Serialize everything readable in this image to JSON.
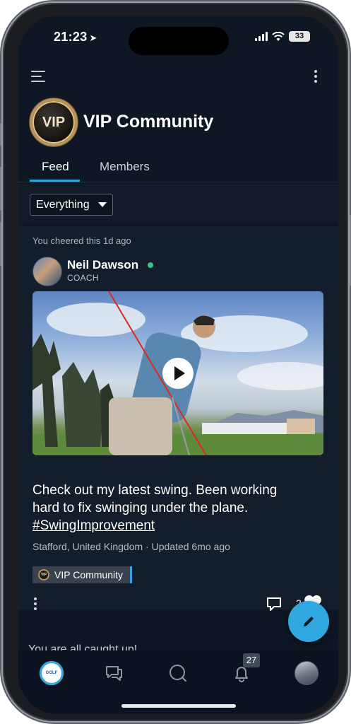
{
  "status_bar": {
    "time": "21:23",
    "battery": "33"
  },
  "header": {
    "community_title": "VIP Community",
    "badge_text": "VIP"
  },
  "tabs": [
    {
      "label": "Feed",
      "active": true
    },
    {
      "label": "Members",
      "active": false
    }
  ],
  "filter": {
    "selected": "Everything"
  },
  "post": {
    "activity": "You cheered this 1d ago",
    "author": {
      "name": "Neil Dawson",
      "role": "COACH",
      "online": true
    },
    "body_lines": [
      "Check out my latest swing. Been working",
      "hard to fix swinging under the plane."
    ],
    "hashtag": "#SwingImprovement",
    "meta": "Stafford, United Kingdom · Updated 6mo ago",
    "community_chip": "VIP Community",
    "like_count": "2"
  },
  "feed_footer": "You are all caught up!",
  "bottom_nav": {
    "notification_count": "27",
    "logo_text": "GOLF"
  },
  "icons": {
    "menu": "hamburger-menu-icon",
    "more": "more-vertical-icon",
    "location": "location-arrow-icon",
    "play": "play-icon",
    "comment": "comment-icon",
    "like": "heart-icon",
    "compose": "pencil-icon",
    "nav": [
      "home-logo-icon",
      "chat-icon",
      "search-icon",
      "bell-icon",
      "profile-avatar-icon"
    ]
  },
  "colors": {
    "background": "#0f1724",
    "accent": "#2ea8de",
    "online": "#36c28a",
    "gold": "#b8945a"
  }
}
